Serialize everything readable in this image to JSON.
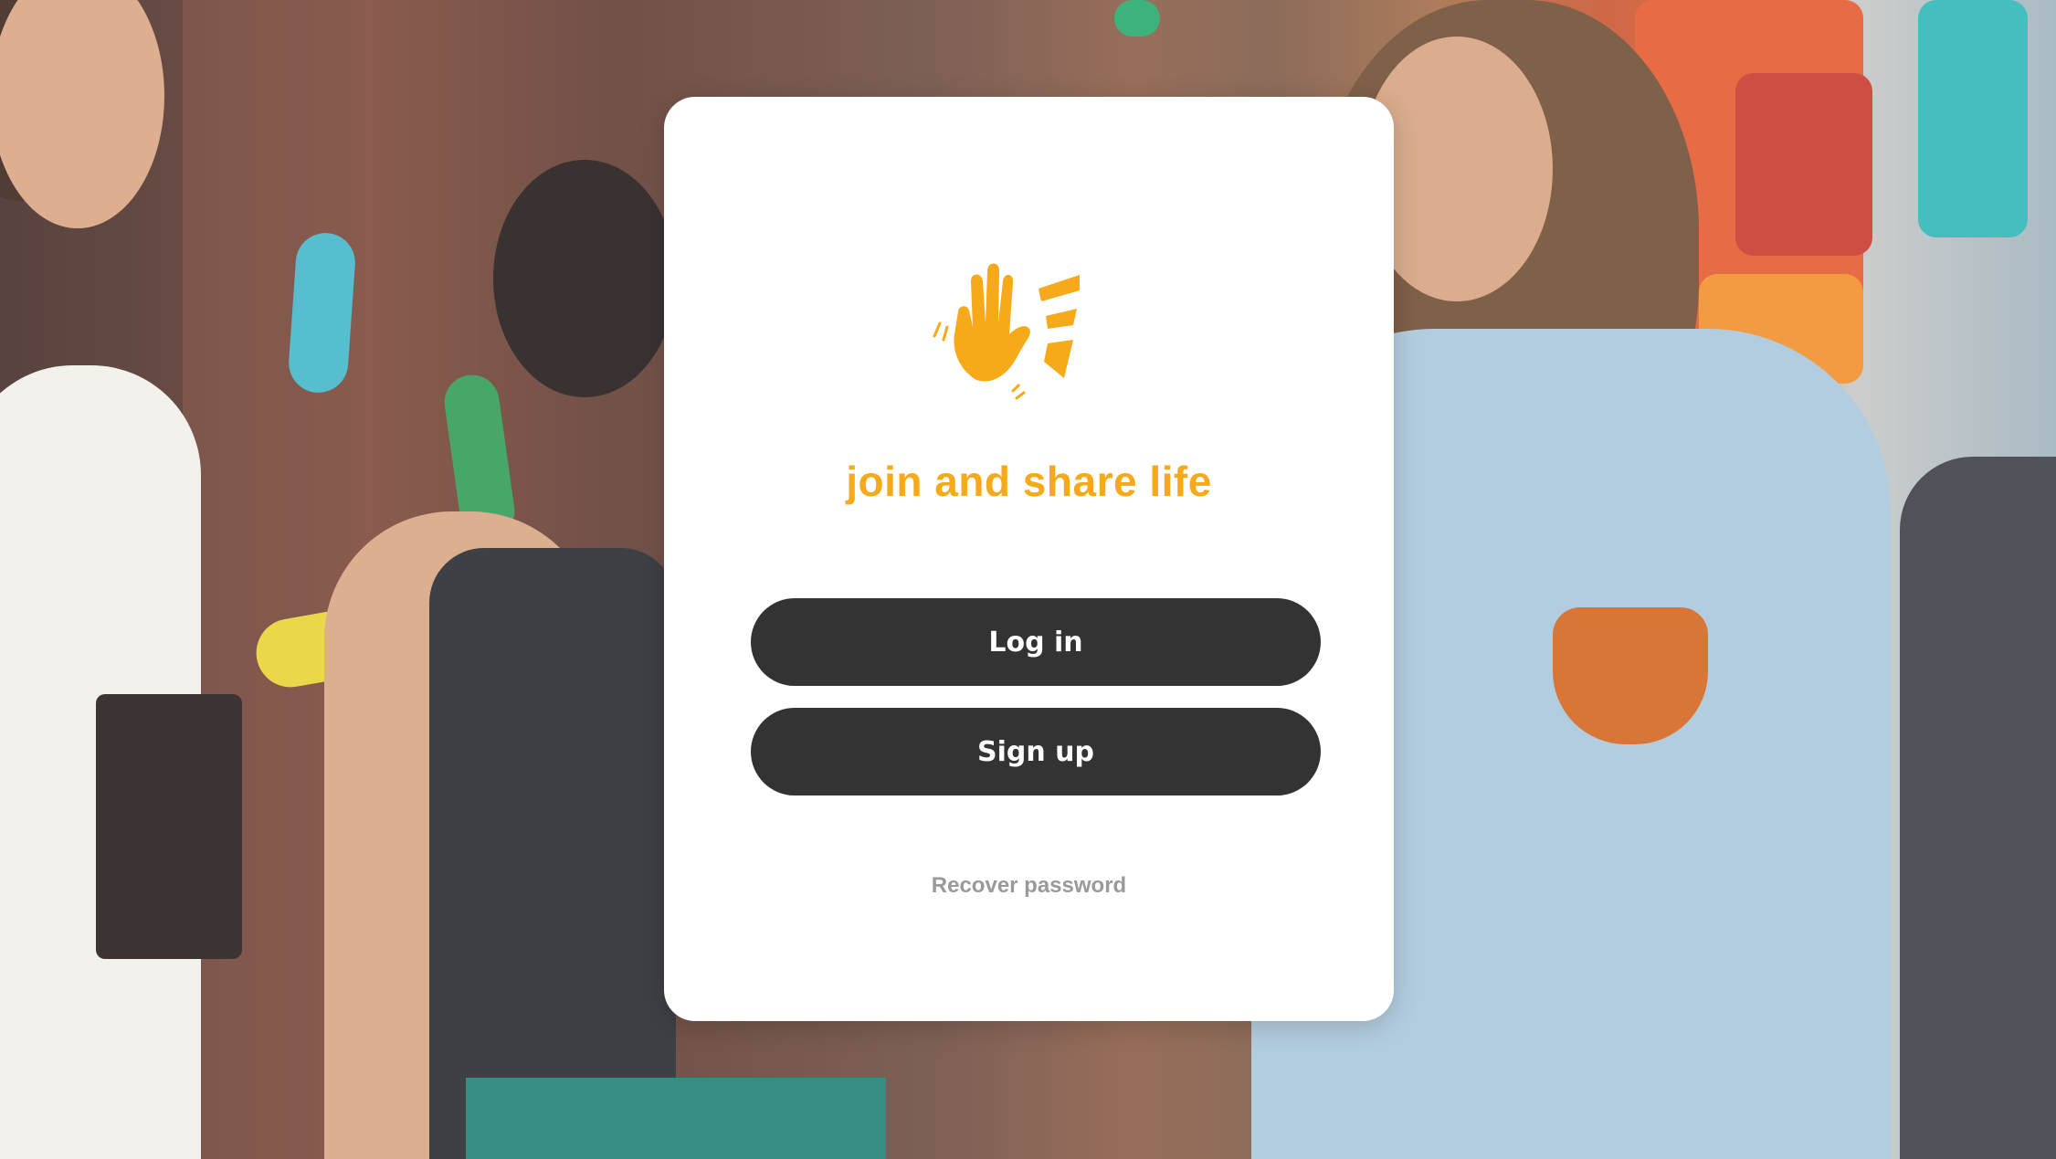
{
  "brand": {
    "tagline": "join and share life",
    "logo_icon": "high-five-hand-icon",
    "accent_color": "#f6a919"
  },
  "actions": {
    "login_label": "Log in",
    "signup_label": "Sign up",
    "recover_label": "Recover password"
  },
  "colors": {
    "button_bg": "#333333",
    "button_text": "#ffffff",
    "link_text": "#9a9a9a",
    "card_bg": "#ffffff"
  }
}
